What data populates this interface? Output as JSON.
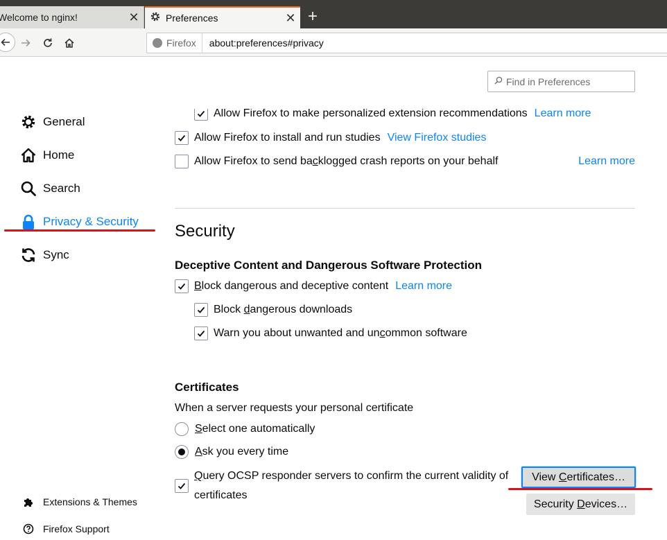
{
  "tabs": [
    {
      "title": "Welcome to nginx!",
      "active": false
    },
    {
      "title": "Preferences",
      "active": true
    }
  ],
  "navbar": {
    "identity_label": "Firefox",
    "url": "about:preferences#privacy"
  },
  "search": {
    "placeholder": "Find in Preferences"
  },
  "sidebar": {
    "items": [
      {
        "label": "General",
        "icon": "gear-icon"
      },
      {
        "label": "Home",
        "icon": "home-icon"
      },
      {
        "label": "Search",
        "icon": "search-icon"
      },
      {
        "label": "Privacy & Security",
        "icon": "lock-icon",
        "selected": true
      },
      {
        "label": "Sync",
        "icon": "sync-icon"
      }
    ],
    "footer": [
      {
        "label": "Extensions & Themes",
        "icon": "puzzle-icon"
      },
      {
        "label": "Firefox Support",
        "icon": "help-icon"
      }
    ]
  },
  "data_collection": {
    "recommendations_label": "Allow Firefox to make personalized extension recommendations",
    "recommendations_link": "Learn more",
    "studies_label": "Allow Firefox to install and run studies",
    "studies_link": "View Firefox studies",
    "crash_label": "Allow Firefox to send backlogged crash reports on your behalf",
    "crash_link": "Learn more"
  },
  "security": {
    "heading": "Security",
    "deceptive_heading": "Deceptive Content and Dangerous Software Protection",
    "block_deceptive_label": "Block dangerous and deceptive content",
    "block_deceptive_link": "Learn more",
    "block_downloads_label": "Block dangerous downloads",
    "warn_unwanted_label": "Warn you about unwanted and uncommon software"
  },
  "certificates": {
    "heading": "Certificates",
    "description": "When a server requests your personal certificate",
    "select_auto_label": "Select one automatically",
    "ask_every_label": "Ask you every time",
    "ocsp_label_line1": "Query OCSP responder servers to confirm the current validity of",
    "ocsp_label_line2": "certificates",
    "view_certificates_label": "View Certificates…",
    "security_devices_label": "Security Devices…"
  },
  "colors": {
    "accent": "#0a84ff",
    "annotation_red": "#d7141d",
    "active_tab_top": "#e66a2c"
  }
}
